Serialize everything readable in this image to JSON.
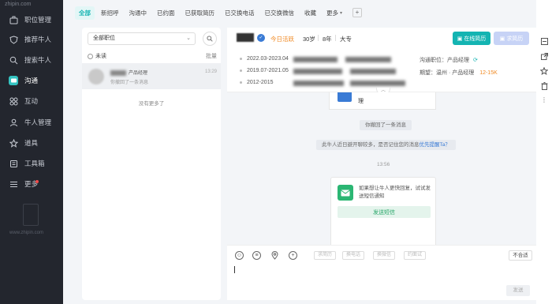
{
  "watermark": "zhipin.com",
  "sidebar": {
    "items": [
      {
        "label": "职位管理",
        "icon": "briefcase-icon"
      },
      {
        "label": "推荐牛人",
        "icon": "shield-icon"
      },
      {
        "label": "搜索牛人",
        "icon": "search-icon"
      },
      {
        "label": "沟通",
        "icon": "chat-icon"
      },
      {
        "label": "互动",
        "icon": "grid-icon"
      },
      {
        "label": "牛人管理",
        "icon": "person-icon"
      },
      {
        "label": "道具",
        "icon": "tag-icon"
      },
      {
        "label": "工具箱",
        "icon": "toolbox-icon"
      },
      {
        "label": "更多",
        "icon": "menu-icon"
      }
    ],
    "active": "沟通",
    "footer_url": "www.zhipin.com"
  },
  "tabs": [
    "全部",
    "新招呼",
    "沟通中",
    "已约面",
    "已获取简历",
    "已交换电话",
    "已交换微信",
    "收藏",
    "更多"
  ],
  "list": {
    "job_filter": "全部职位",
    "unread_label": "未读",
    "batch_label": "批量",
    "conversation": {
      "job": "产品经理",
      "preview": "你撤回了一条消息",
      "time": "13:29"
    },
    "no_more": "没有更多了"
  },
  "chat": {
    "header": {
      "active_status": "今日活跃",
      "age": "30岁",
      "experience": "8年",
      "education": "大专",
      "online_resume_btn": "在线简历",
      "request_resume_btn": "求简历"
    },
    "experiences": [
      {
        "period": "2022.03-2023.04"
      },
      {
        "period": "2019.07-2021.05"
      },
      {
        "period": "2012-2015"
      }
    ],
    "comm_job_label": "沟通职位：",
    "comm_job_value": "产品经理",
    "expect_label": "期望：",
    "expect_value": "温州 · 产品经理",
    "expect_salary": "12-15K",
    "card_top_text": "理",
    "recall_msg": "你撤回了一条消息",
    "reminder_msg": "此牛人近日避开聊较多，是否记住您的消息",
    "reminder_link": "优先提醒Ta？",
    "timestamp": "13:56",
    "sms_card": {
      "text": "如果想让牛人更快回复，试试发送短信通知",
      "button": "发送短信"
    },
    "toolbar": {
      "quick_buttons": [
        "求简历",
        "换电话",
        "换微信",
        "约面试"
      ],
      "not_suitable": "不合适"
    },
    "input_value": "",
    "send_label": "发送"
  },
  "colors": {
    "accent": "#14b4b2",
    "sidebar_bg": "#23262e",
    "orange": "#f08a24",
    "sms_green": "#2bb673"
  }
}
